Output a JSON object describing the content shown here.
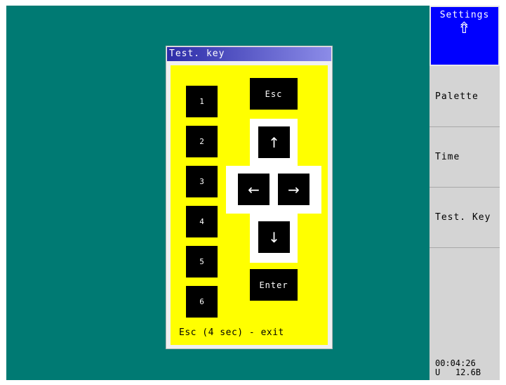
{
  "dialog": {
    "title": "Test. key",
    "number_keys": [
      "1",
      "2",
      "3",
      "4",
      "5",
      "6"
    ],
    "esc_label": "Esc",
    "enter_label": "Enter",
    "arrows": {
      "up": "↑",
      "left": "←",
      "right": "→",
      "down": "↓"
    },
    "footer": "Esc (4 sec) - exit"
  },
  "side_menu": {
    "settings_label": "Settings",
    "settings_icon": "⇮",
    "items": [
      "Palette",
      "Time",
      "Test. Key"
    ]
  },
  "status": {
    "time": "00:04:26",
    "unit": "U",
    "voltage": "12.6B"
  },
  "colors": {
    "background": "#007a73",
    "panel": "#ffff00",
    "title_bar": "#2c2ca8",
    "active_menu": "#0000ff",
    "side_menu": "#d4d4d4"
  }
}
